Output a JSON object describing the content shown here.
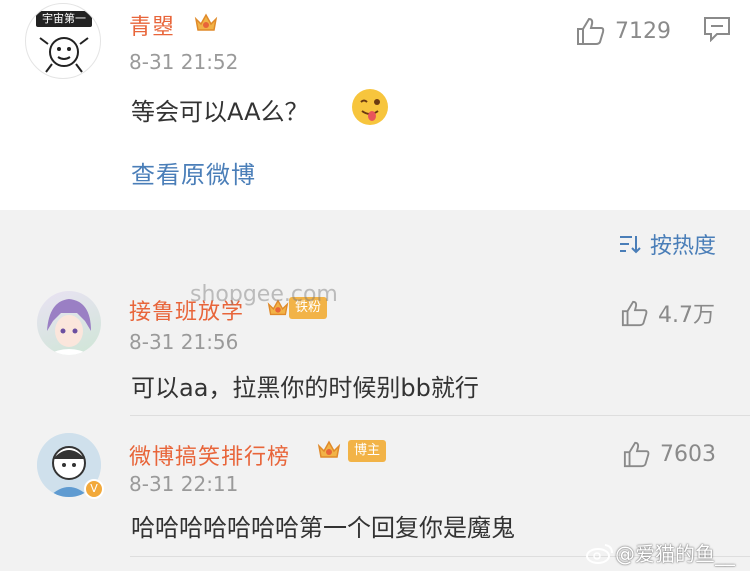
{
  "main_comment": {
    "avatar_caption": "宇宙第一",
    "username": "青曌",
    "time": "8-31 21:52",
    "text": "等会可以AA么？",
    "likes": "7129",
    "view_original": "查看原微博"
  },
  "sort": {
    "label": "按热度"
  },
  "replies": [
    {
      "username": "接鲁班放学",
      "badge": "铁粉",
      "time": "8-31 21:56",
      "text": "可以aa，拉黑你的时候别bb就行",
      "likes": "4.7万"
    },
    {
      "username": "微博搞笑排行榜",
      "badge": "博主",
      "time": "8-31 22:11",
      "text": "哈哈哈哈哈哈哈第一个回复你是魔鬼",
      "likes": "7603"
    }
  ],
  "watermarks": {
    "center": "shopgee.com",
    "corner": "@爱猫的鱼__"
  },
  "colors": {
    "username": "#e8653a",
    "link": "#4a7eb8",
    "muted": "#9a9a9a",
    "bg_gray": "#f2f2f2"
  }
}
